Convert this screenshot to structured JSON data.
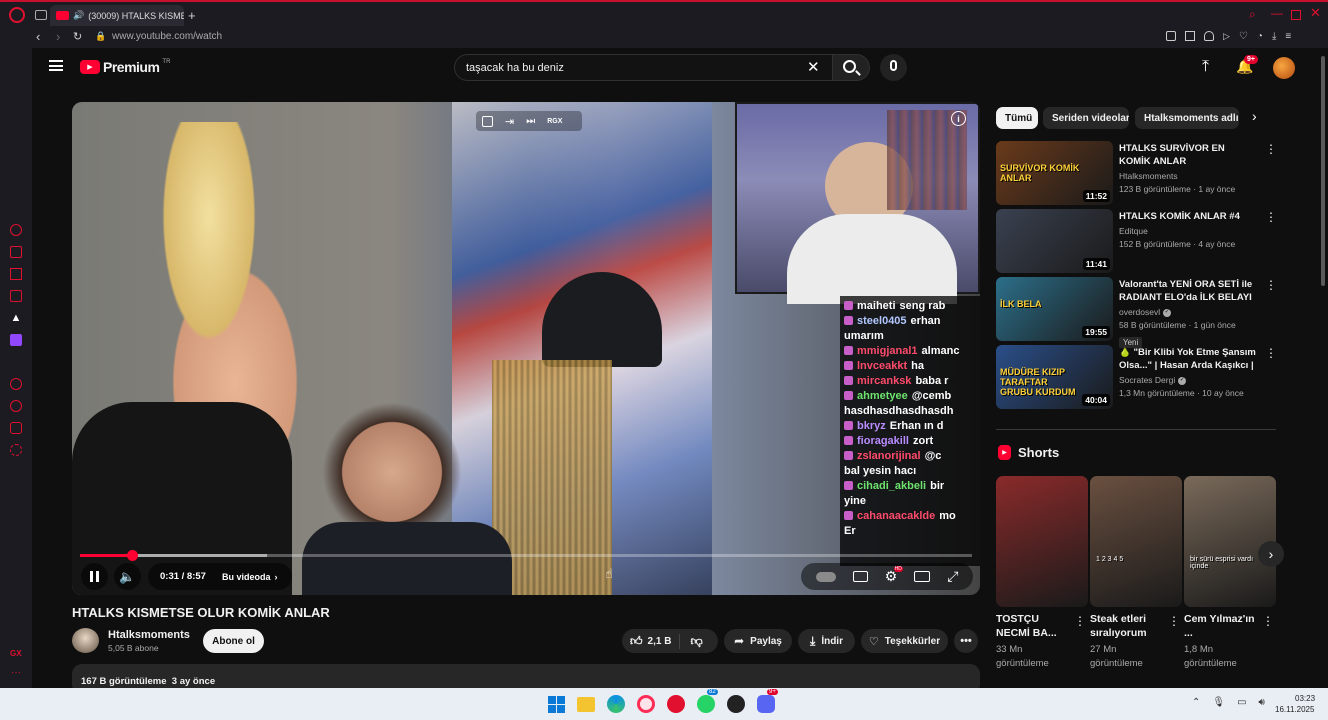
{
  "browser": {
    "tab_title": "(30009) HTALKS KISME",
    "url": "www.youtube.com/watch",
    "notification_badge": "9+"
  },
  "youtube": {
    "logo": "Premium",
    "logo_region": "TR",
    "search_value": "taşacak ha bu deniz",
    "notification_count": "9+"
  },
  "player": {
    "time": "0:31 / 8:57",
    "chapter": "Bu videoda",
    "progress_fraction": 0.058,
    "buffer_fraction": 0.21,
    "top_badge": "RGX",
    "chat": [
      {
        "user": "maiheti",
        "msg": "seng rab",
        "color": "#ffffff"
      },
      {
        "user": "steel0405",
        "msg": "erhan",
        "color": "#b1c7ff"
      },
      {
        "user": "",
        "msg": "umarım",
        "color": "#ffffff"
      },
      {
        "user": "mmigjanal1",
        "msg": "almanc",
        "color": "#ff4b6b"
      },
      {
        "user": "lnvceakkt",
        "msg": "ha",
        "color": "#ff4b6b"
      },
      {
        "user": "mircanksk",
        "msg": "baba r",
        "color": "#ff4b6b"
      },
      {
        "user": "ahmetyee",
        "msg": "@cemb",
        "color": "#6ee36e"
      },
      {
        "user": "",
        "msg": "hasdhasdhasdhasdh",
        "color": "#ffffff"
      },
      {
        "user": "bkryz",
        "msg": "Erhan ın d",
        "color": "#b98cff"
      },
      {
        "user": "fioragakill",
        "msg": "zort",
        "color": "#b98cff"
      },
      {
        "user": "zslanorijinal",
        "msg": "@c",
        "color": "#ff4b6b"
      },
      {
        "user": "",
        "msg": "bal yesin hacı",
        "color": "#ffffff"
      },
      {
        "user": "cihadi_akbeli",
        "msg": "bir",
        "color": "#6ee36e"
      },
      {
        "user": "",
        "msg": "yine",
        "color": "#ffffff"
      },
      {
        "user": "cahanaacaklde",
        "msg": "mo",
        "color": "#ff4b6b"
      },
      {
        "user": "",
        "msg": "Er",
        "color": "#ffffff"
      }
    ]
  },
  "video": {
    "title": "HTALKS KISMETSE OLUR KOMİK ANLAR",
    "channel": "Htalksmoments",
    "subscribers": "5,05 B abone",
    "subscribe_label": "Abone ol",
    "likes": "2,1 B",
    "share_label": "Paylaş",
    "download_label": "İndir",
    "thanks_label": "Teşekkürler",
    "views_line": "167 B görüntüleme  3 ay önce"
  },
  "chips": [
    "Tümü",
    "Seriden videolar",
    "Htalksmoments adlı y"
  ],
  "recommendations": [
    {
      "title": "HTALKS SURVİVOR EN KOMİK ANLAR",
      "channel": "Htalksmoments",
      "verified": false,
      "meta": "123 B görüntüleme · 1 ay önce",
      "duration": "11:52",
      "badge": "",
      "thumb_text": "SURVİVOR KOMİK ANLAR",
      "thumb_color": "#6a3a1a"
    },
    {
      "title": "HTALKS KOMİK ANLAR #4",
      "channel": "Editque",
      "verified": false,
      "meta": "152 B görüntüleme · 4 ay önce",
      "duration": "11:41",
      "badge": "",
      "thumb_text": "",
      "thumb_color": "#3a4150"
    },
    {
      "title": "Valorant'ta YENİ ORA SETİ ile RADIANT ELO'da İLK BELAYI ...",
      "channel": "overdosevl",
      "verified": true,
      "meta": "58 B görüntüleme · 1 gün önce",
      "duration": "19:55",
      "badge": "Yeni",
      "thumb_text": "İLK BELA",
      "thumb_color": "#2c6f8a"
    },
    {
      "title": "🍐 \"Bir Klibi Yok Etme Şansım Olsa...\" | Hasan Arda Kaşıkcı | ...",
      "channel": "Socrates Dergi",
      "verified": true,
      "meta": "1,3 Mn görüntüleme · 10 ay önce",
      "duration": "40:04",
      "badge": "",
      "thumb_text": "MÜDÜRE KIZIP TARAFTAR GRUBU KURDUM",
      "thumb_color": "#2a4f8a"
    }
  ],
  "shorts": {
    "heading": "Shorts",
    "items": [
      {
        "title": "TOSTÇU NECMİ BA...",
        "views": "33 Mn görüntüleme",
        "thumb_color": "#8a2a2a",
        "thumb_text": ""
      },
      {
        "title": "Steak etleri sıralıyorum",
        "views": "27 Mn görüntüleme",
        "thumb_color": "#6a5040",
        "thumb_text": "1 2 3 4 5"
      },
      {
        "title": "Cem Yılmaz'ın ...",
        "views": "1,8 Mn görüntüleme",
        "thumb_color": "#7a6a5a",
        "thumb_text": "bir sürü esprisi vardı içinde"
      }
    ]
  },
  "taskbar": {
    "time": "03:23",
    "date": "16.11.2025",
    "whatsapp_badge": "82",
    "discord_badge": "9+"
  }
}
